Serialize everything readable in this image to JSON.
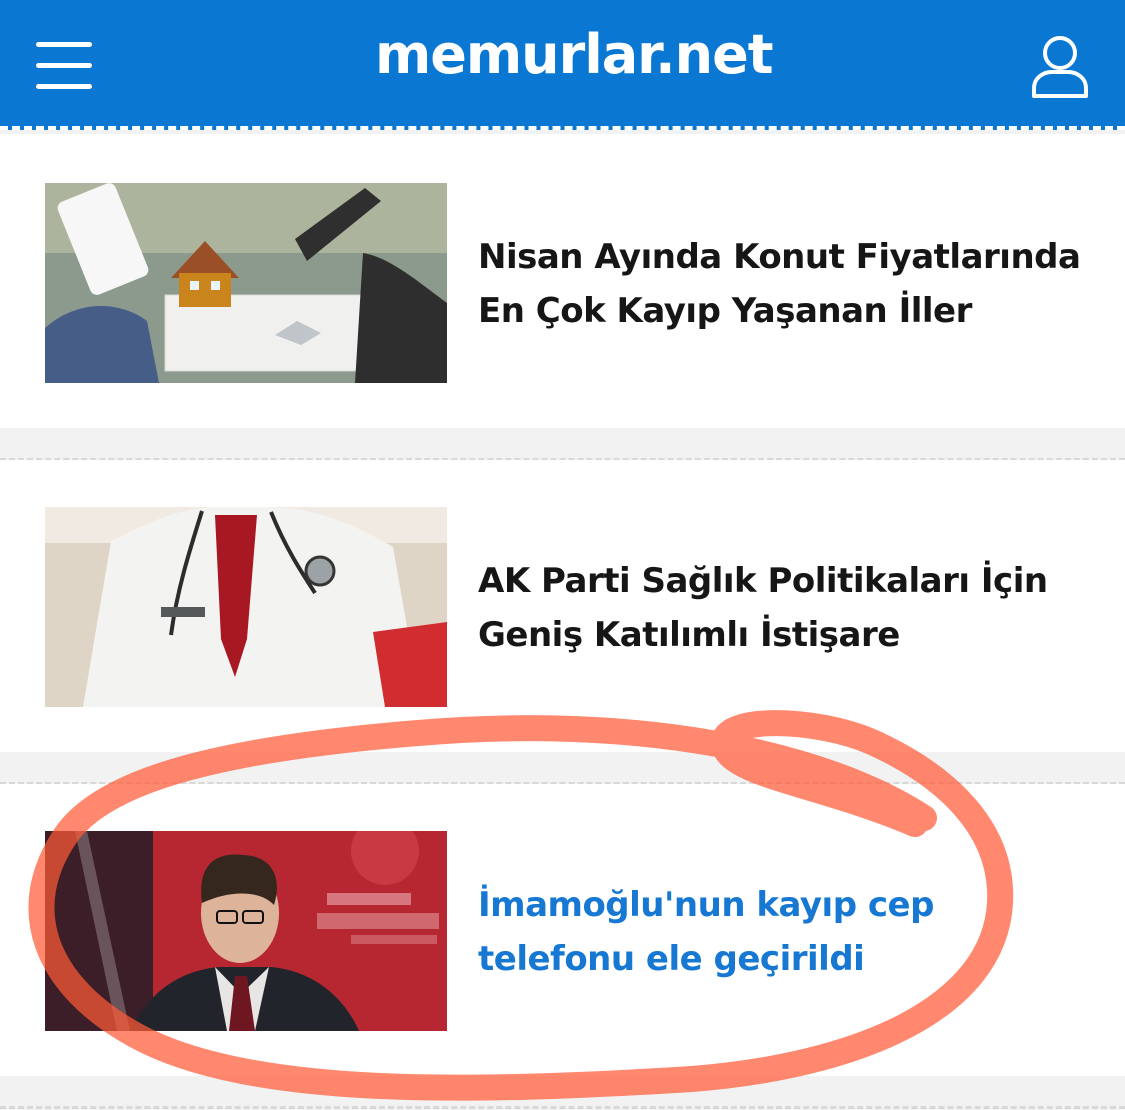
{
  "header": {
    "logo_main": "memurlar",
    "logo_suffix": ".net",
    "menu_icon": "hamburger-menu-icon",
    "user_icon": "user-profile-icon",
    "brand_color": "#0a77d2"
  },
  "news": [
    {
      "title": "Nisan Ayında Konut Fiyatlarında En Çok Kayıp Yaşanan İller",
      "image": "house-model-and-contract-photo",
      "title_color": "#161616"
    },
    {
      "title": "AK Parti Sağlık Politikaları İçin Geniş Katılımlı İstişare",
      "image": "doctor-with-stethoscope-photo",
      "title_color": "#161616"
    },
    {
      "title": "İmamoğlu'nun kayıp cep telefonu ele geçirildi",
      "image": "man-speaking-at-istanbul-buyuksehir-belediyesi-event-photo",
      "title_color": "#1678d2"
    }
  ],
  "annotation": {
    "shape": "hand-drawn-circle",
    "color": "#ff5a36"
  }
}
